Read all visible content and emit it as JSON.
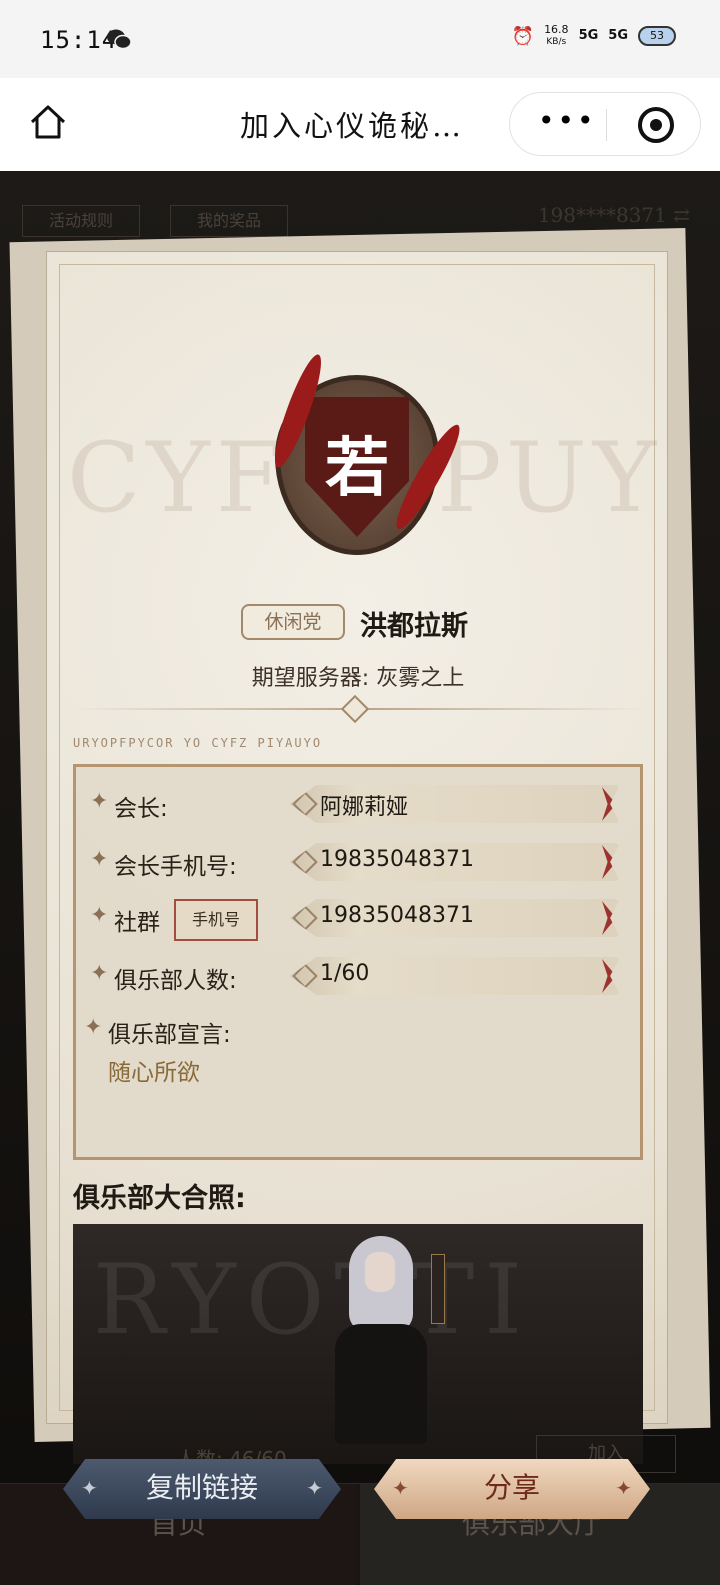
{
  "status_bar": {
    "time": "15:14",
    "speed": "16.8",
    "speed_unit": "KB/s",
    "net1": "5G",
    "net2": "5G",
    "battery": "53"
  },
  "nav": {
    "title": "加入心仪诡秘…",
    "more": "•••"
  },
  "top_tabs": [
    "活动规则",
    "我的奖品"
  ],
  "account": "198****8371 ⇄",
  "club": {
    "emblem_char": "若",
    "tag": "休闲党",
    "name": "洪都拉斯",
    "server_label": "期望服务器: 灰雾之上",
    "motto": "URYOPFPYCOR YO CYFZ PIYAUYO",
    "rows": [
      {
        "label": "会长:",
        "value": "阿娜莉娅"
      },
      {
        "label": "会长手机号:",
        "value": "19835048371"
      },
      {
        "label": "社群",
        "value": "19835048371",
        "sub_button": "手机号"
      },
      {
        "label": "俱乐部人数:",
        "value": "1/60"
      }
    ],
    "declaration_label": "俱乐部宣言:",
    "declaration": "随心所欲",
    "photo_title": "俱乐部大合照:",
    "photo_ghost_text": "RYOTTI",
    "bg_runes": [
      "CYFZ",
      "PUY"
    ]
  },
  "faint": {
    "count": "人数: 46/60",
    "join": "加入"
  },
  "buttons": {
    "copy": "复制链接",
    "share": "分享"
  },
  "bottom_tabs": {
    "home": "首页",
    "lobby": "俱乐部大厅"
  }
}
